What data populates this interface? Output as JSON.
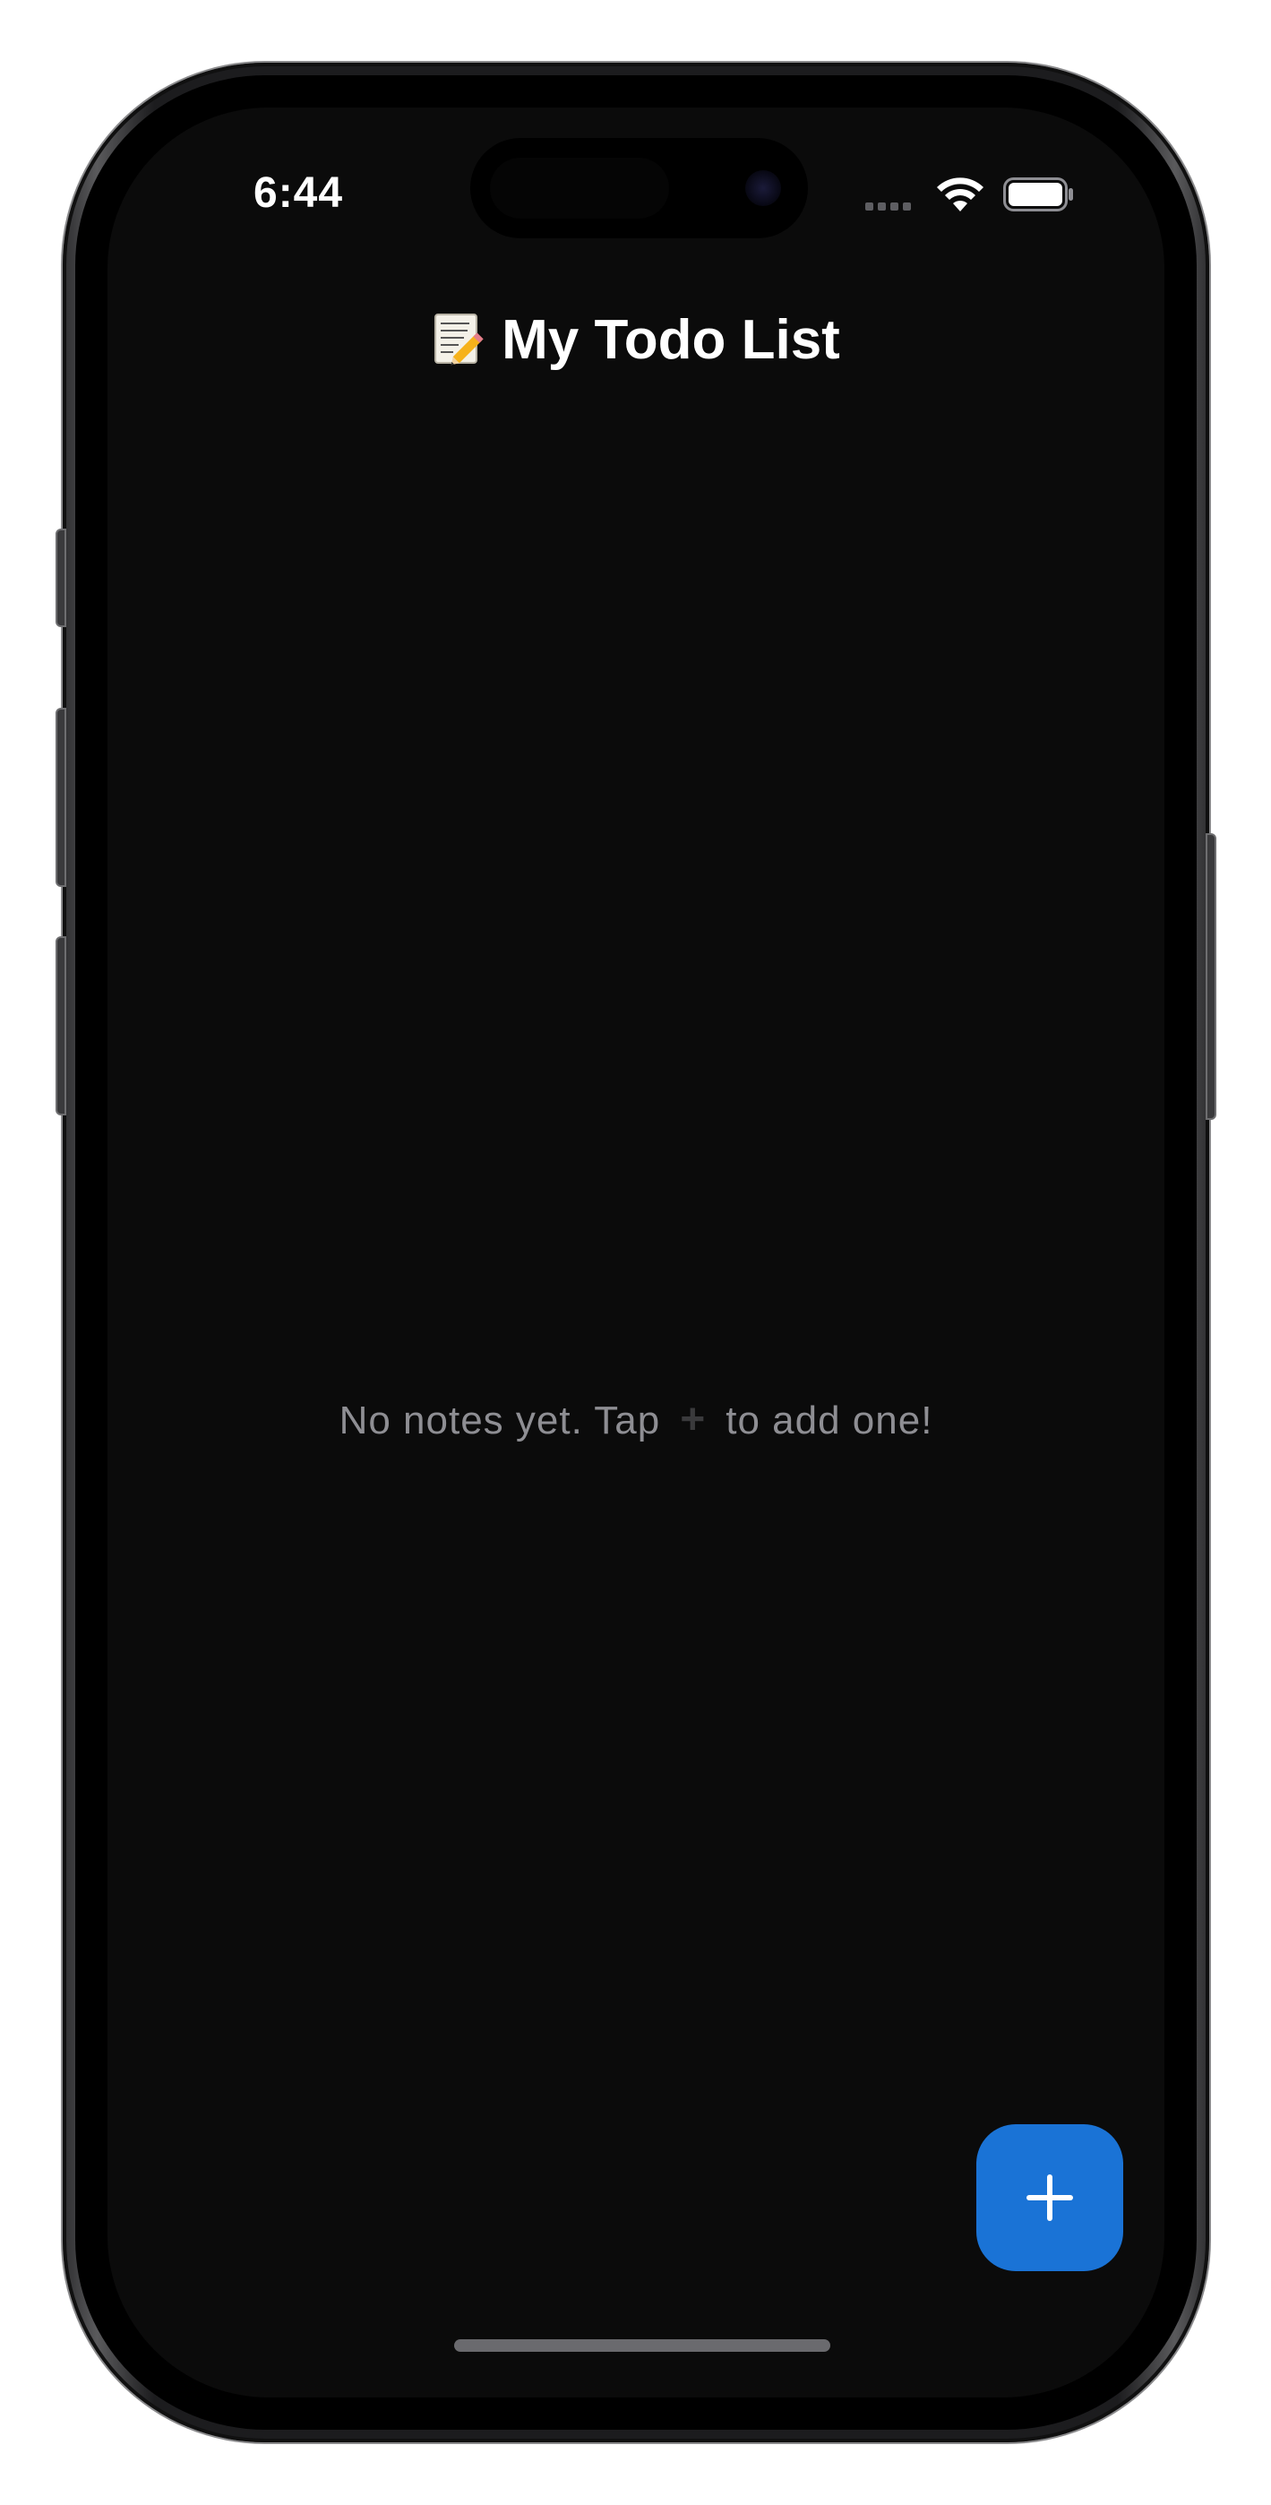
{
  "status_bar": {
    "time": "6:44",
    "icons": [
      "cellular-signal-icon",
      "wifi-icon",
      "battery-icon"
    ]
  },
  "header": {
    "emoji_icon": "memo-pencil-icon",
    "title": "My Todo List"
  },
  "empty_state": {
    "text_before": "No notes yet. Tap",
    "inline_icon": "+",
    "text_after": "to add one!"
  },
  "fab": {
    "icon": "plus-icon"
  },
  "colors": {
    "background": "#0b0b0b",
    "accent": "#1a73d6",
    "title": "#ffffff",
    "muted_text": "#8e8e93"
  }
}
